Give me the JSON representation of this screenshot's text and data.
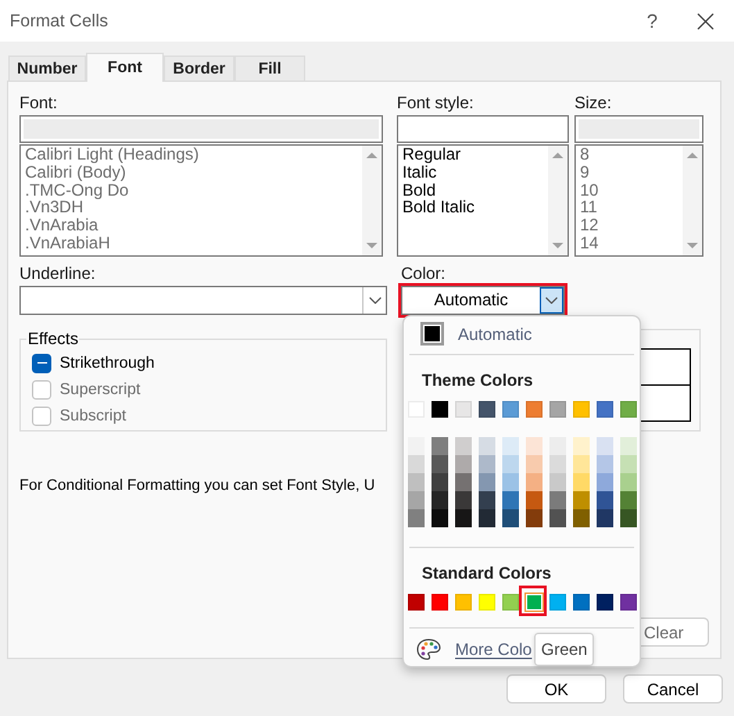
{
  "window": {
    "title": "Format Cells",
    "help": "?"
  },
  "tabs": [
    {
      "label": "Number",
      "selected": false
    },
    {
      "label": "Font",
      "selected": true
    },
    {
      "label": "Border",
      "selected": false
    },
    {
      "label": "Fill",
      "selected": false
    }
  ],
  "font": {
    "label": "Font:",
    "disabled": true,
    "items": [
      "Calibri Light (Headings)",
      "Calibri (Body)",
      ".TMC-Ong Do",
      ".Vn3DH",
      ".VnArabia",
      ".VnArabiaH"
    ]
  },
  "font_style": {
    "label": "Font style:",
    "disabled": false,
    "items": [
      "Regular",
      "Italic",
      "Bold",
      "Bold Italic"
    ]
  },
  "size": {
    "label": "Size:",
    "disabled": true,
    "items": [
      "8",
      "9",
      "10",
      "11",
      "12",
      "14"
    ]
  },
  "underline": {
    "label": "Underline:"
  },
  "color": {
    "label": "Color:",
    "value": "Automatic",
    "open": true,
    "highlighted": true
  },
  "effects": {
    "title": "Effects",
    "items": [
      {
        "label": "Strikethrough",
        "checked": true,
        "indeterminate": true,
        "disabled": false
      },
      {
        "label": "Superscript",
        "checked": false,
        "indeterminate": false,
        "disabled": true
      },
      {
        "label": "Subscript",
        "checked": false,
        "indeterminate": false,
        "disabled": true
      }
    ]
  },
  "note": "For Conditional Formatting you can set Font Style, U",
  "clear_button": "Clear",
  "color_menu": {
    "automatic": {
      "label": "Automatic",
      "color": "#000000"
    },
    "theme_title": "Theme Colors",
    "theme_colors": [
      {
        "color": "#ffffff",
        "shades": [
          {
            "color": "#f2f2f2"
          },
          {
            "color": "#d9d9d9"
          },
          {
            "color": "#bfbfbf"
          },
          {
            "color": "#a6a6a6"
          },
          {
            "color": "#808080"
          }
        ]
      },
      {
        "color": "#000000",
        "shades": [
          {
            "color": "#7f7f7f"
          },
          {
            "color": "#595959"
          },
          {
            "color": "#404040"
          },
          {
            "color": "#262626"
          },
          {
            "color": "#0d0d0d"
          }
        ]
      },
      {
        "color": "#e7e6e6",
        "shades": [
          {
            "color": "#d0cece"
          },
          {
            "color": "#aeaaaa"
          },
          {
            "color": "#757171"
          },
          {
            "color": "#3a3838"
          },
          {
            "color": "#171616"
          }
        ]
      },
      {
        "color": "#44546a",
        "shades": [
          {
            "color": "#d6dce4"
          },
          {
            "color": "#adb9ca"
          },
          {
            "color": "#8497b0"
          },
          {
            "color": "#333f4f"
          },
          {
            "color": "#222a35"
          }
        ]
      },
      {
        "color": "#5b9bd5",
        "shades": [
          {
            "color": "#ddebf7"
          },
          {
            "color": "#bdd7ee"
          },
          {
            "color": "#9bc2e6"
          },
          {
            "color": "#2f75b5"
          },
          {
            "color": "#1f4e78"
          }
        ]
      },
      {
        "color": "#ed7d31",
        "shades": [
          {
            "color": "#fce4d6"
          },
          {
            "color": "#f8cbad"
          },
          {
            "color": "#f4b084"
          },
          {
            "color": "#c65911"
          },
          {
            "color": "#833c0c"
          }
        ]
      },
      {
        "color": "#a5a5a5",
        "shades": [
          {
            "color": "#ededed"
          },
          {
            "color": "#dbdbdb"
          },
          {
            "color": "#c9c9c9"
          },
          {
            "color": "#7b7b7b"
          },
          {
            "color": "#525252"
          }
        ]
      },
      {
        "color": "#ffc000",
        "shades": [
          {
            "color": "#fff2cc"
          },
          {
            "color": "#ffe699"
          },
          {
            "color": "#ffd966"
          },
          {
            "color": "#bf8f00"
          },
          {
            "color": "#806000"
          }
        ]
      },
      {
        "color": "#4472c4",
        "shades": [
          {
            "color": "#d9e1f2"
          },
          {
            "color": "#b4c6e7"
          },
          {
            "color": "#8ea9db"
          },
          {
            "color": "#305496"
          },
          {
            "color": "#203764"
          }
        ]
      },
      {
        "color": "#70ad47",
        "shades": [
          {
            "color": "#e2efda"
          },
          {
            "color": "#c6e0b4"
          },
          {
            "color": "#a9d08e"
          },
          {
            "color": "#548235"
          },
          {
            "color": "#375623"
          }
        ]
      }
    ],
    "standard_title": "Standard Colors",
    "standard_colors": [
      {
        "color": "#c00000",
        "selected": false,
        "highlighted": false
      },
      {
        "color": "#ff0000",
        "selected": false,
        "highlighted": false
      },
      {
        "color": "#ffc000",
        "selected": false,
        "highlighted": false
      },
      {
        "color": "#ffff00",
        "selected": false,
        "highlighted": false
      },
      {
        "color": "#92d050",
        "selected": false,
        "highlighted": false
      },
      {
        "color": "#00b050",
        "selected": true,
        "highlighted": true
      },
      {
        "color": "#00b0f0",
        "selected": false,
        "highlighted": false
      },
      {
        "color": "#0070c0",
        "selected": false,
        "highlighted": false
      },
      {
        "color": "#002060",
        "selected": false,
        "highlighted": false
      },
      {
        "color": "#7030a0",
        "selected": false,
        "highlighted": false
      }
    ],
    "more_colors": "More Colo",
    "tooltip": "Green"
  },
  "buttons": [
    "OK",
    "Cancel"
  ]
}
